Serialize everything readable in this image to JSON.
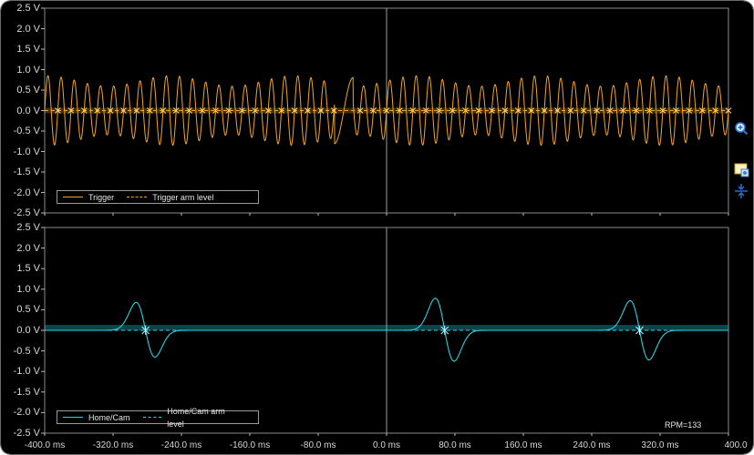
{
  "colors": {
    "background": "#000000",
    "grid": "#3a3a3a",
    "trigger": "#f5a623",
    "home_cam": "#27d3e2",
    "axis_text": "#d8d8d8"
  },
  "panels": {
    "top": {
      "y_ticks": [
        "2.5 V",
        "2.0 V",
        "1.5 V",
        "1.0 V",
        "0.5 V",
        "0.0 V",
        "-0.5 V",
        "-1.0 V",
        "-1.5 V",
        "-2.0 V",
        "-2.5 V"
      ],
      "legend": {
        "series_label": "Trigger",
        "arm_label": "Trigger arm level"
      }
    },
    "bottom": {
      "y_ticks": [
        "2.5 V",
        "2.0 V",
        "1.5 V",
        "1.0 V",
        "0.5 V",
        "0.0 V",
        "-0.5 V",
        "-1.0 V",
        "-1.5 V",
        "-2.0 V",
        "-2.5 V"
      ],
      "legend": {
        "series_label": "Home/Cam",
        "arm_label": "Home/Cam arm level"
      },
      "rpm": "RPM=133"
    }
  },
  "x_ticks": [
    "-400.0 ms",
    "-320.0 ms",
    "-240.0 ms",
    "-160.0 ms",
    "-80.0 ms",
    "0.0 ms",
    "80.0 ms",
    "160.0 ms",
    "240.0 ms",
    "320.0 ms",
    "400.0"
  ],
  "toolbar": {
    "zoom_icon": "zoom-in-icon",
    "image_icon": "picture-icon",
    "scale_icon": "scale-compress-icon"
  },
  "chart_data": [
    {
      "type": "line",
      "series": [
        {
          "name": "Trigger"
        },
        {
          "name": "Trigger arm level"
        }
      ],
      "ylim": [
        -2.5,
        2.5
      ],
      "xlim_ms": [
        -400,
        400
      ],
      "arm_level_v": 0.0,
      "signal": {
        "kind": "sinusoid",
        "amplitude_v": 0.85,
        "cycles_in_view": 52,
        "gap_center_ms": -50,
        "gap_width_ms": 22
      }
    },
    {
      "type": "line",
      "series": [
        {
          "name": "Home/Cam"
        },
        {
          "name": "Home/Cam arm level"
        }
      ],
      "ylim": [
        -2.5,
        2.5
      ],
      "xlim_ms": [
        -400,
        400
      ],
      "arm_level_v": 0.0,
      "pulses": [
        {
          "cross_ms": -282,
          "peak_v": 0.68,
          "trough_v": -0.65
        },
        {
          "cross_ms": 68,
          "peak_v": 0.78,
          "trough_v": -0.75
        },
        {
          "cross_ms": 296,
          "peak_v": 0.72,
          "trough_v": -0.72
        }
      ]
    }
  ]
}
